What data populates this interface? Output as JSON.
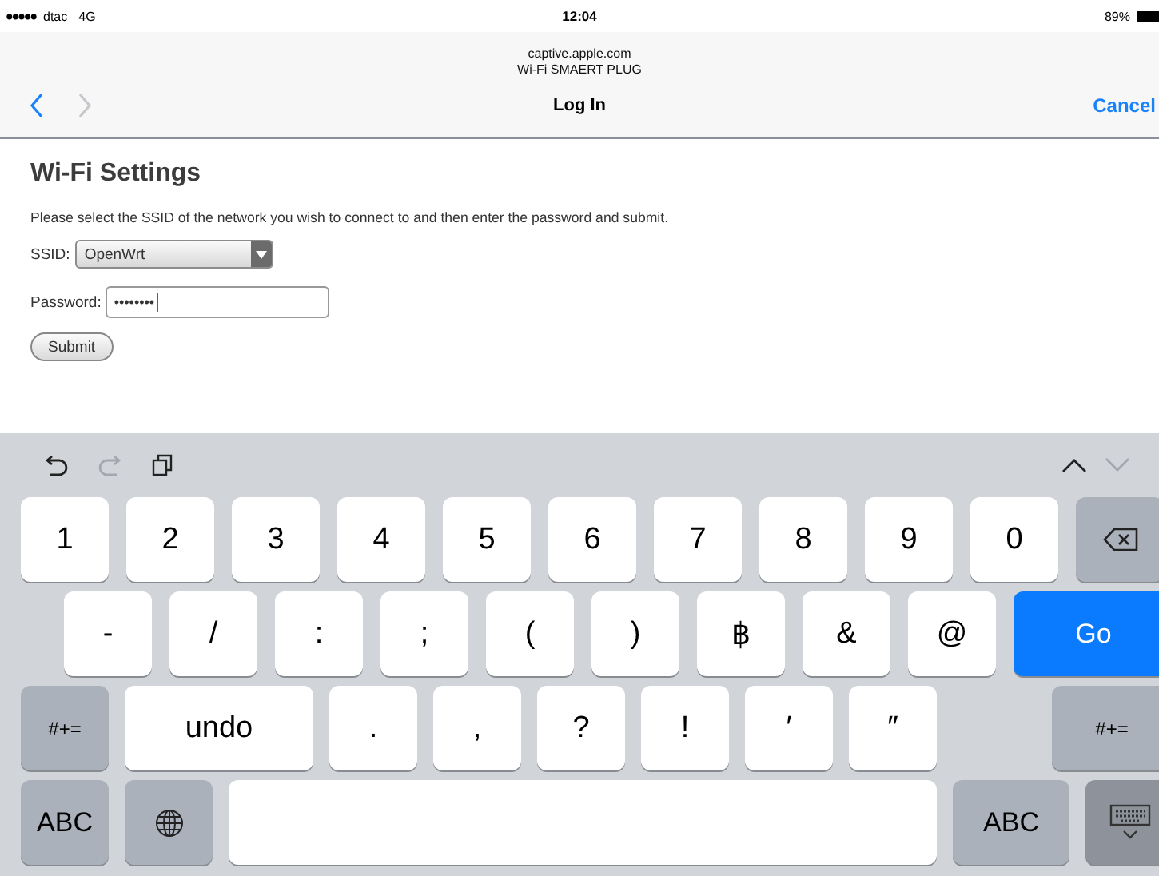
{
  "status_bar": {
    "carrier": "dtac",
    "network": "4G",
    "time": "12:04",
    "battery": "89%"
  },
  "header": {
    "domain": "captive.apple.com",
    "page_title": "Wi-Fi SMAERT PLUG",
    "title": "Log In",
    "cancel": "Cancel",
    "back_disabled": false,
    "forward_disabled": true
  },
  "form": {
    "heading": "Wi-Fi Settings",
    "instructions": "Please select the SSID of the network you wish to connect to and then enter the password and submit.",
    "ssid_label": "SSID:",
    "ssid_value": "OpenWrt",
    "password_label": "Password:",
    "password_value": "••••••••",
    "submit": "Submit"
  },
  "keyboard": {
    "toolbar": [
      {
        "kind": "undo",
        "disabled": false
      },
      {
        "kind": "redo",
        "disabled": true
      },
      {
        "kind": "paste",
        "disabled": false
      },
      {
        "kind": "up",
        "disabled": false
      },
      {
        "kind": "down",
        "disabled": true
      }
    ],
    "rows": [
      [
        {
          "kind": "char",
          "text": "1"
        },
        {
          "kind": "char",
          "text": "2"
        },
        {
          "kind": "char",
          "text": "3"
        },
        {
          "kind": "char",
          "text": "4"
        },
        {
          "kind": "char",
          "text": "5"
        },
        {
          "kind": "char",
          "text": "6"
        },
        {
          "kind": "char",
          "text": "7"
        },
        {
          "kind": "char",
          "text": "8"
        },
        {
          "kind": "char",
          "text": "9"
        },
        {
          "kind": "char",
          "text": "0"
        },
        {
          "kind": "delete"
        }
      ],
      [
        {
          "kind": "char",
          "text": "-"
        },
        {
          "kind": "char",
          "text": "/"
        },
        {
          "kind": "char",
          "text": ":"
        },
        {
          "kind": "char",
          "text": ";"
        },
        {
          "kind": "char",
          "text": "("
        },
        {
          "kind": "char",
          "text": ")"
        },
        {
          "kind": "char",
          "text": "฿"
        },
        {
          "kind": "char",
          "text": "&"
        },
        {
          "kind": "char",
          "text": "@"
        },
        {
          "kind": "go",
          "text": "Go"
        }
      ],
      [
        {
          "kind": "fn",
          "text": "#+="
        },
        {
          "kind": "wide",
          "text": "undo"
        },
        {
          "kind": "char",
          "text": "."
        },
        {
          "kind": "char",
          "text": ","
        },
        {
          "kind": "char",
          "text": "?"
        },
        {
          "kind": "char",
          "text": "!"
        },
        {
          "kind": "char",
          "text": "′"
        },
        {
          "kind": "char",
          "text": "″"
        },
        {
          "kind": "fn-end",
          "text": "#+="
        }
      ],
      [
        {
          "kind": "abc",
          "text": "ABC"
        },
        {
          "kind": "globe"
        },
        {
          "kind": "space"
        },
        {
          "kind": "abc-end",
          "text": "ABC"
        },
        {
          "kind": "hide"
        }
      ]
    ]
  }
}
